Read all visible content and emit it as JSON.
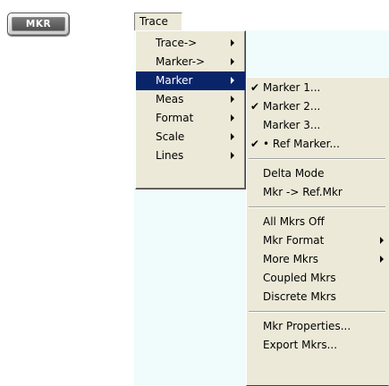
{
  "hardkey": {
    "label": "MKR"
  },
  "menubar": {
    "trace_label": "Trace"
  },
  "trace_menu": {
    "items": [
      {
        "label": "Trace->",
        "has_submenu": true
      },
      {
        "label": "Marker->",
        "has_submenu": true
      },
      {
        "label": "Marker",
        "has_submenu": true,
        "highlighted": true
      },
      {
        "label": "Meas",
        "has_submenu": true
      },
      {
        "label": "Format",
        "has_submenu": true
      },
      {
        "label": "Scale",
        "has_submenu": true
      },
      {
        "label": "Lines",
        "has_submenu": true
      }
    ]
  },
  "marker_menu": {
    "check_glyph": "✔",
    "group1": [
      {
        "label": "Marker 1...",
        "checked": true
      },
      {
        "label": "Marker 2...",
        "checked": true
      },
      {
        "label": "Marker 3...",
        "checked": false
      },
      {
        "label": "• Ref Marker...",
        "checked": true
      }
    ],
    "group2": [
      {
        "label": "Delta Mode"
      },
      {
        "label": "Mkr -> Ref.Mkr"
      }
    ],
    "group3": [
      {
        "label": "All Mkrs Off",
        "has_submenu": false
      },
      {
        "label": "Mkr Format",
        "has_submenu": true
      },
      {
        "label": "More Mkrs",
        "has_submenu": true
      },
      {
        "label": "Coupled Mkrs",
        "has_submenu": false
      },
      {
        "label": "Discrete Mkrs",
        "has_submenu": false
      }
    ],
    "group4": [
      {
        "label": "Mkr Properties..."
      },
      {
        "label": "Export Mkrs..."
      }
    ]
  },
  "colors": {
    "menu_bg": "#ece9d8",
    "highlight_bg": "#0a246a",
    "backdrop": "#f0fbfc"
  }
}
